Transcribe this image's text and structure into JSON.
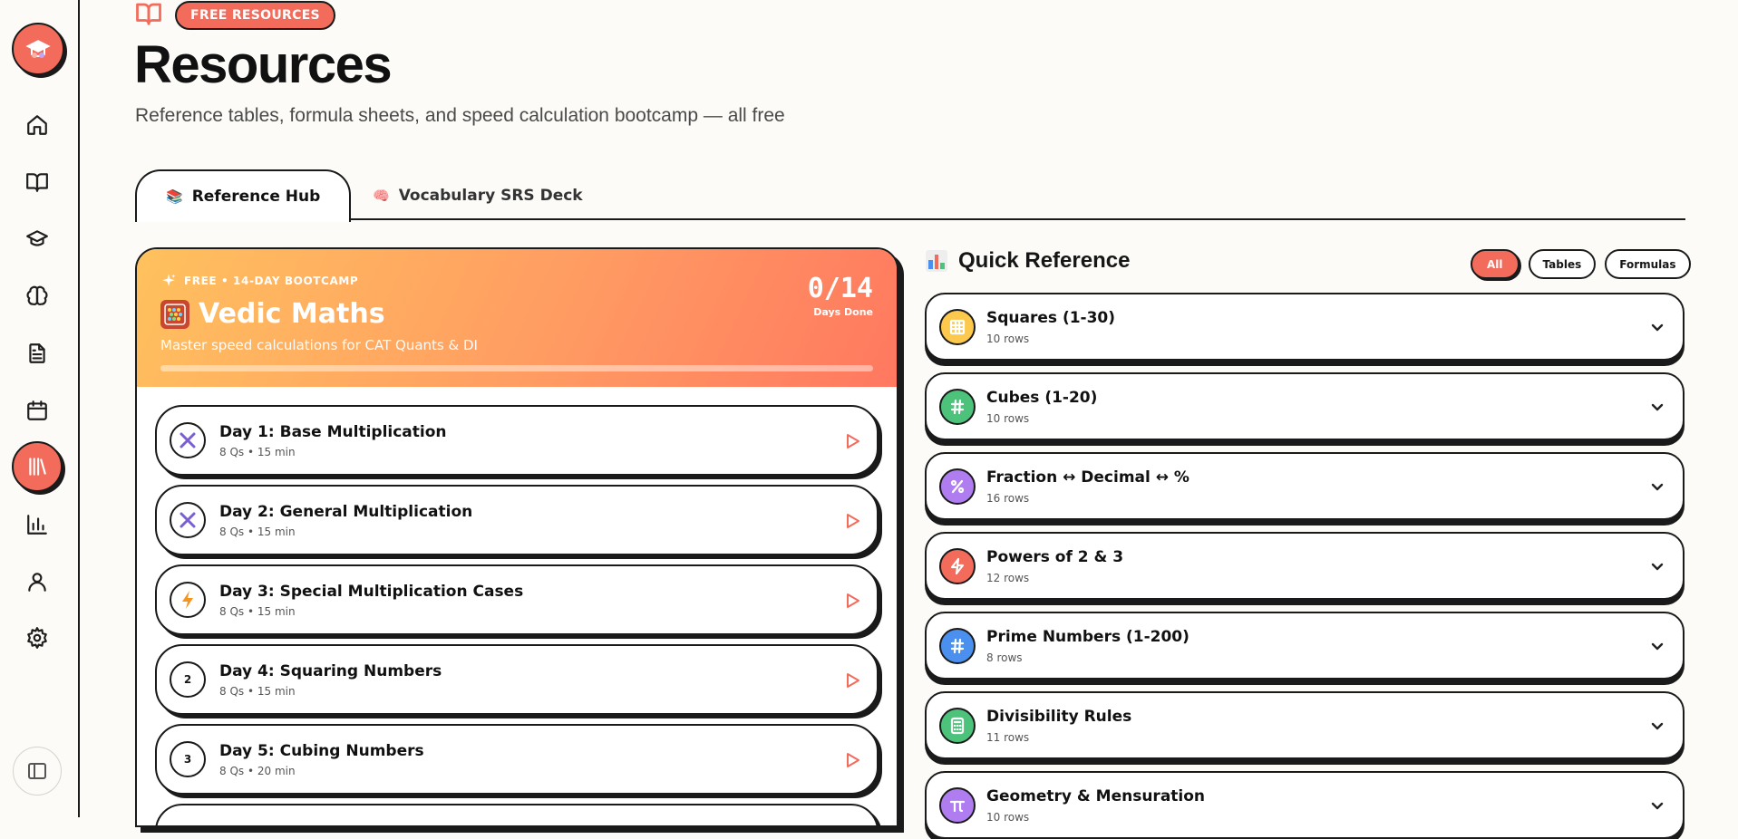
{
  "header": {
    "badge": "FREE RESOURCES",
    "title": "Resources",
    "subtitle": "Reference tables, formula sheets, and speed calculation bootcamp — all free"
  },
  "tabs": [
    {
      "emoji": "📚",
      "label": "Reference Hub",
      "active": true
    },
    {
      "emoji": "🧠",
      "label": "Vocabulary SRS Deck",
      "active": false
    }
  ],
  "bootcamp": {
    "tag": "FREE • 14-DAY BOOTCAMP",
    "emoji": "🧮",
    "title": "Vedic Maths",
    "description": "Master speed calculations for CAT Quants & DI",
    "count": "0/14",
    "count_label": "Days Done",
    "progress": 0,
    "days": [
      {
        "title": "Day 1: Base Multiplication",
        "meta": "8 Qs • 15 min",
        "icon": "multiply-icon"
      },
      {
        "title": "Day 2: General Multiplication",
        "meta": "8 Qs • 15 min",
        "icon": "multiply-icon"
      },
      {
        "title": "Day 3: Special Multiplication Cases",
        "meta": "8 Qs • 15 min",
        "icon": "lightning-icon"
      },
      {
        "title": "Day 4: Squaring Numbers",
        "meta": "8 Qs • 15 min",
        "icon": "superscript-2",
        "glyph": "2"
      },
      {
        "title": "Day 5: Cubing Numbers",
        "meta": "8 Qs • 20 min",
        "icon": "superscript-3",
        "glyph": "3"
      }
    ]
  },
  "quick_reference": {
    "title": "Quick Reference",
    "filters": [
      {
        "label": "All",
        "active": true
      },
      {
        "label": "Tables",
        "active": false
      },
      {
        "label": "Formulas",
        "active": false
      }
    ],
    "items": [
      {
        "title": "Squares (1-30)",
        "rows": "10 rows",
        "icon": "grid-icon",
        "color": "#fcc94c"
      },
      {
        "title": "Cubes (1-20)",
        "rows": "10 rows",
        "icon": "hash-icon",
        "color": "#4cc27a"
      },
      {
        "title": "Fraction ↔ Decimal ↔ %",
        "rows": "16 rows",
        "icon": "percent-icon",
        "color": "#b07df0"
      },
      {
        "title": "Powers of 2 & 3",
        "rows": "12 rows",
        "icon": "zap-icon",
        "color": "#f26b5b"
      },
      {
        "title": "Prime Numbers (1-200)",
        "rows": "8 rows",
        "icon": "hash-icon",
        "color": "#4b90ee"
      },
      {
        "title": "Divisibility Rules",
        "rows": "11 rows",
        "icon": "calculator-icon",
        "color": "#4cc27a"
      },
      {
        "title": "Geometry & Mensuration",
        "rows": "10 rows",
        "icon": "pi-icon",
        "color": "#b07df0"
      }
    ]
  },
  "colors": {
    "accent": "#f26b5b",
    "ink": "#1a1a1a",
    "background": "#fcfbf7"
  }
}
